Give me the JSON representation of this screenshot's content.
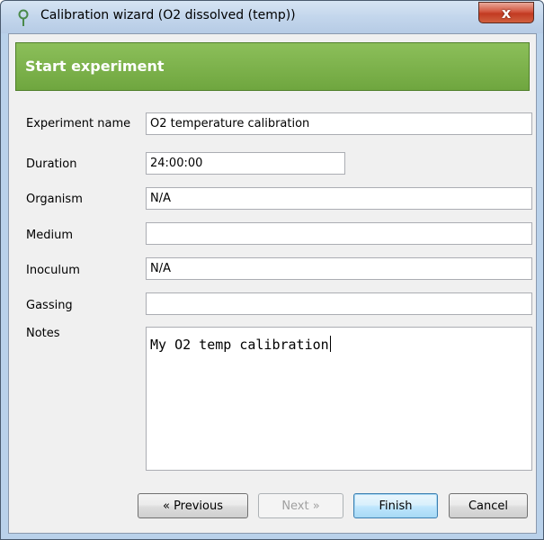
{
  "window": {
    "title": "Calibration wizard (O2 dissolved (temp))",
    "close_label": "x"
  },
  "header": {
    "title": "Start experiment"
  },
  "form": {
    "experiment_name": {
      "label": "Experiment name",
      "value": "O2 temperature calibration"
    },
    "duration": {
      "label": "Duration",
      "value": "24:00:00"
    },
    "organism": {
      "label": "Organism",
      "value": "N/A"
    },
    "medium": {
      "label": "Medium",
      "value": ""
    },
    "inoculum": {
      "label": "Inoculum",
      "value": "N/A"
    },
    "gassing": {
      "label": "Gassing",
      "value": ""
    },
    "notes": {
      "label": "Notes",
      "value": "My O2 temp calibration"
    }
  },
  "buttons": {
    "previous": "« Previous",
    "next": "Next »",
    "finish": "Finish",
    "cancel": "Cancel"
  },
  "colors": {
    "header_green": "#76ad45",
    "close_red": "#c9452b",
    "window_frame": "#b9d1ea"
  },
  "icons": {
    "app_icon": "pin-icon",
    "close": "close-icon"
  }
}
